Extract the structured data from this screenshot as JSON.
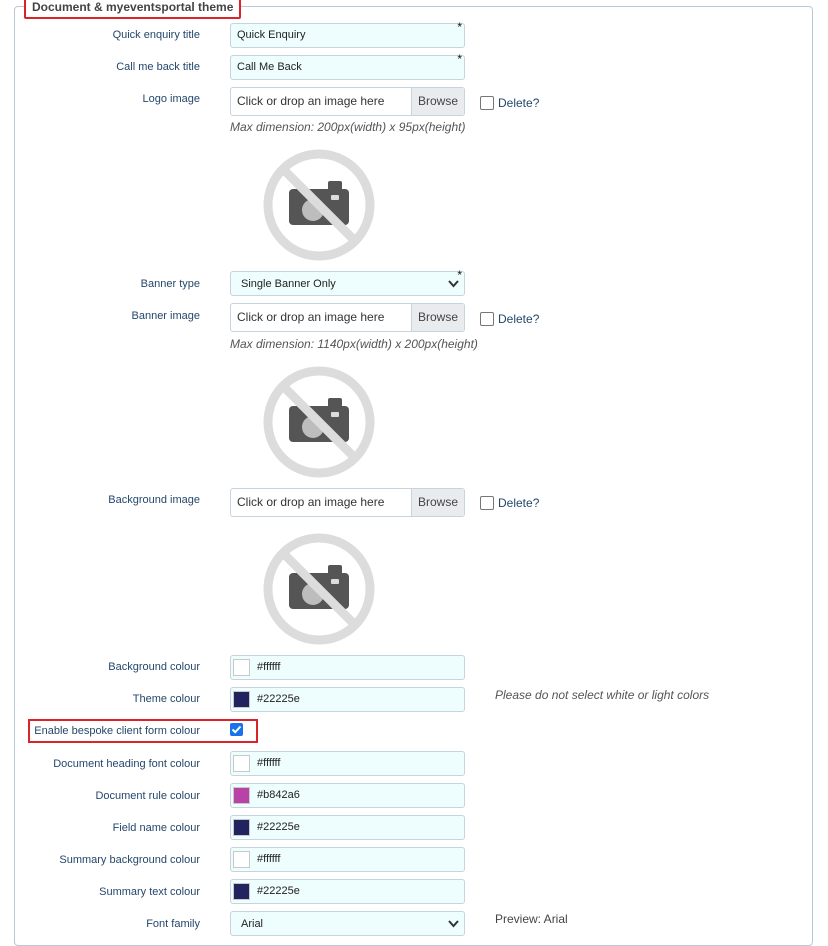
{
  "section": {
    "title": "Document & myeventsportal theme"
  },
  "fields": {
    "quick_enquiry_title": {
      "label": "Quick enquiry title",
      "value": "Quick Enquiry",
      "required": "*"
    },
    "call_me_back_title": {
      "label": "Call me back title",
      "value": "Call Me Back",
      "required": "*"
    },
    "logo_image": {
      "label": "Logo image",
      "placeholder": "Click or drop an image here",
      "browse": "Browse",
      "delete": "Delete?",
      "hint": "Max dimension: 200px(width) x 95px(height)"
    },
    "banner_type": {
      "label": "Banner type",
      "value": "Single Banner Only",
      "required": "*"
    },
    "banner_image": {
      "label": "Banner image",
      "placeholder": "Click or drop an image here",
      "browse": "Browse",
      "delete": "Delete?",
      "hint": "Max dimension: 1140px(width) x 200px(height)"
    },
    "background_image": {
      "label": "Background image",
      "placeholder": "Click or drop an image here",
      "browse": "Browse",
      "delete": "Delete?"
    },
    "background_colour": {
      "label": "Background colour",
      "value": "#ffffff"
    },
    "theme_colour": {
      "label": "Theme colour",
      "value": "#22225e",
      "note": "Please do not select white or light colors"
    },
    "bespoke_client_form_colour": {
      "label": "Enable bespoke client form colour",
      "checked": true
    },
    "document_heading_font_colour": {
      "label": "Document heading font colour",
      "value": "#ffffff"
    },
    "document_rule_colour": {
      "label": "Document rule colour",
      "value": "#b842a6"
    },
    "field_name_colour": {
      "label": "Field name colour",
      "value": "#22225e"
    },
    "summary_background_colour": {
      "label": "Summary background colour",
      "value": "#ffffff"
    },
    "summary_text_colour": {
      "label": "Summary text colour",
      "value": "#22225e"
    },
    "font_family": {
      "label": "Font family",
      "value": "Arial",
      "preview": "Preview: Arial"
    }
  },
  "icons": {
    "placeholder_image": "no-image-icon",
    "select_arrow": "chevron-down-icon",
    "checkbox_checked": "checkmark-icon"
  },
  "colors": {
    "accent": "#1a73e8",
    "highlight_border": "#d9252a",
    "input_bg": "#eefdfd"
  }
}
